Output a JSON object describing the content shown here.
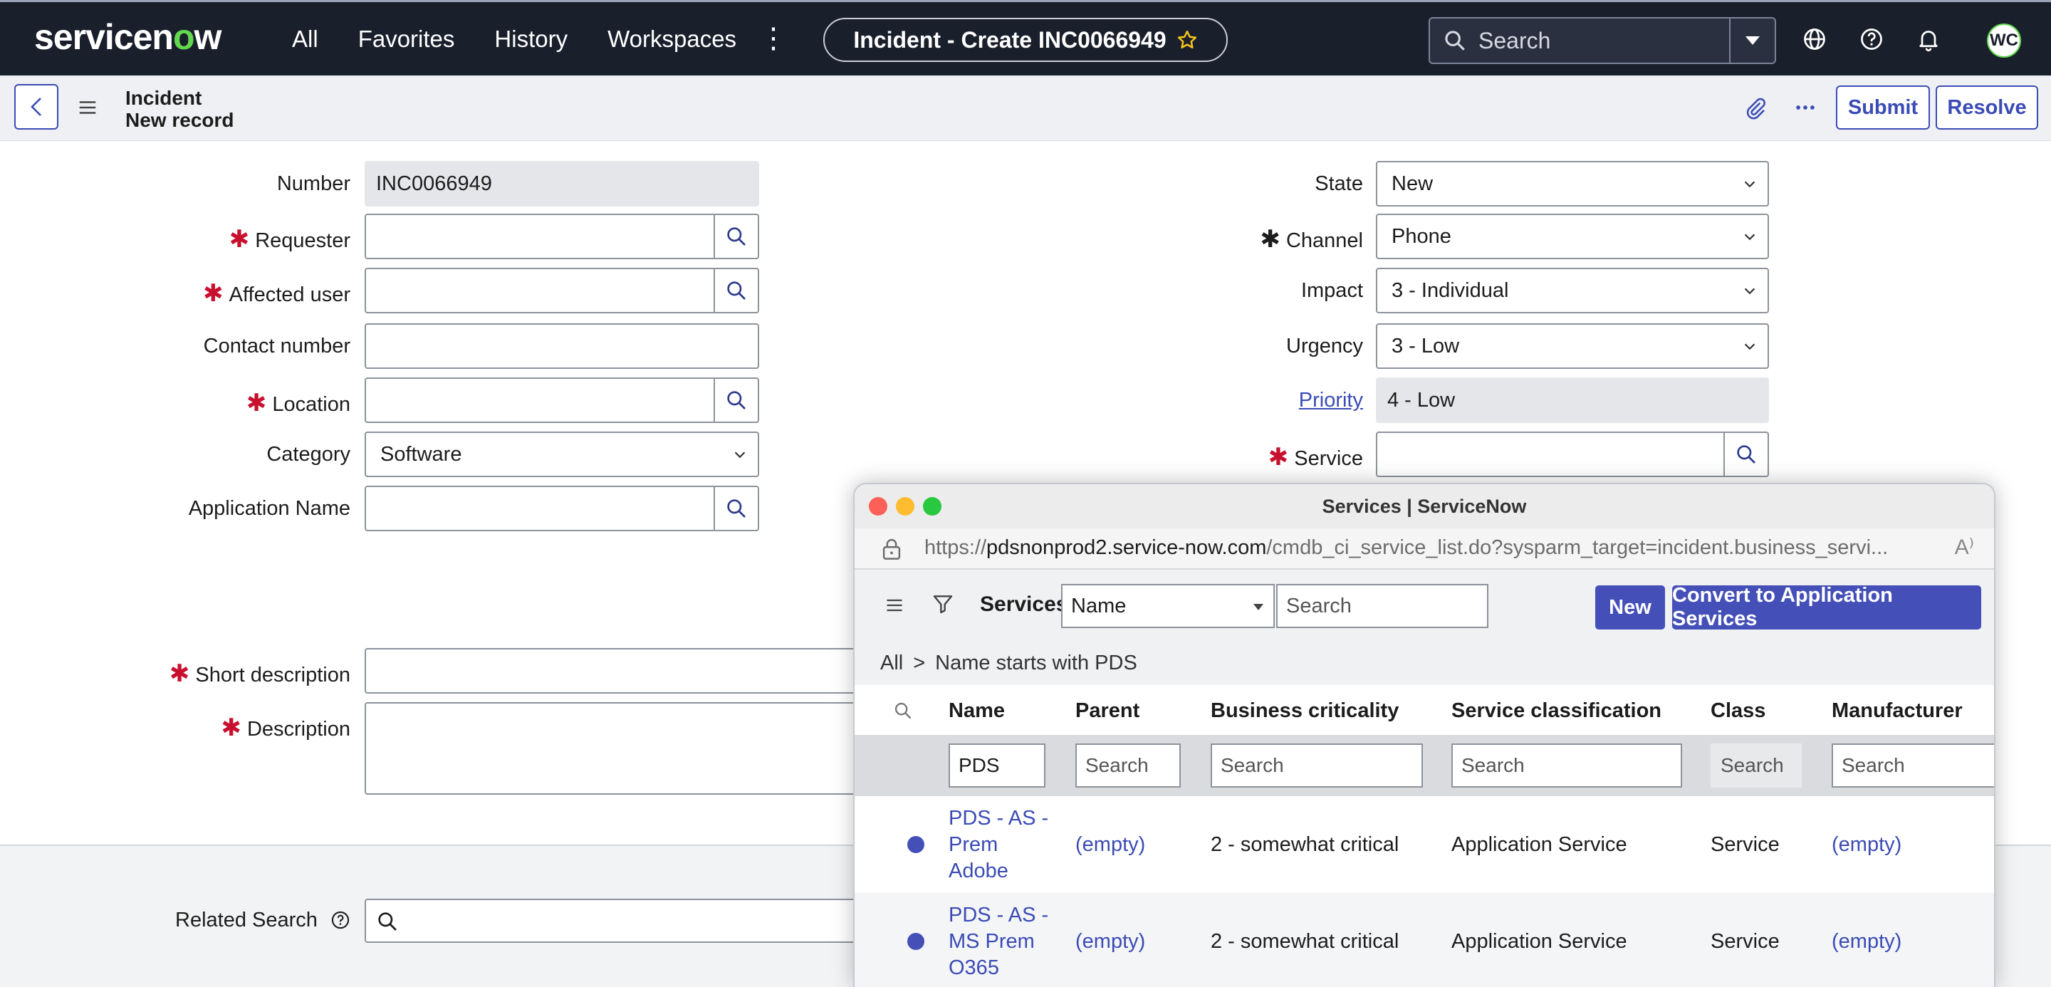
{
  "nav": {
    "logo_prefix": "servicen",
    "logo_o": "o",
    "logo_suffix": "w",
    "links": [
      "All",
      "Favorites",
      "History",
      "Workspaces"
    ],
    "more": "⋮",
    "tab_title": "Incident - Create INC0066949",
    "search_placeholder": "Search",
    "avatar_initials": "WC"
  },
  "record": {
    "table": "Incident",
    "subtitle": "New record",
    "submit": "Submit",
    "resolve": "Resolve"
  },
  "form": {
    "number_label": "Number",
    "number_value": "INC0066949",
    "requester_label": "Requester",
    "affected_user_label": "Affected user",
    "contact_number_label": "Contact number",
    "location_label": "Location",
    "category_label": "Category",
    "category_value": "Software",
    "application_name_label": "Application Name",
    "short_description_label": "Short description",
    "description_label": "Description",
    "state_label": "State",
    "state_value": "New",
    "channel_label": "Channel",
    "channel_value": "Phone",
    "impact_label": "Impact",
    "impact_value": "3 - Individual",
    "urgency_label": "Urgency",
    "urgency_value": "3 - Low",
    "priority_label": "Priority",
    "priority_value": "4 - Low",
    "service_label": "Service",
    "related_search_label": "Related Search"
  },
  "popup": {
    "window_title": "Services | ServiceNow",
    "url_prefix": "https://",
    "url_host": "pdsnonprod2.service-now.com",
    "url_path": "/cmdb_ci_service_list.do?sysparm_target=incident.business_servi...",
    "reader_icon": "A⁾",
    "list_title": "Services",
    "field_select": "Name",
    "search_placeholder": "Search",
    "new_button": "New",
    "convert_button": "Convert to Application Services",
    "breadcrumb_all": "All",
    "breadcrumb_sep": ">",
    "breadcrumb_filter": "Name starts with PDS",
    "columns": [
      "Name",
      "Parent",
      "Business criticality",
      "Service classification",
      "Class",
      "Manufacturer"
    ],
    "filters": [
      "PDS",
      "Search",
      "Search",
      "Search",
      "Search",
      "Search"
    ],
    "rows": [
      {
        "name": [
          "PDS - AS -",
          "Prem",
          "Adobe"
        ],
        "parent": "(empty)",
        "criticality": "2 - somewhat critical",
        "classification": "Application Service",
        "class": "Service",
        "manufacturer": "(empty)"
      },
      {
        "name": [
          "PDS - AS -",
          "MS Prem",
          "O365"
        ],
        "parent": "(empty)",
        "criticality": "2 - somewhat critical",
        "classification": "Application Service",
        "class": "Service",
        "manufacturer": "(empty)"
      }
    ]
  },
  "colors": {
    "nav_bg": "#1a1f2c",
    "accent": "#3a4bb5",
    "button_primary": "#4450b8",
    "required": "#c8102e",
    "logo_green": "#62d84e"
  }
}
